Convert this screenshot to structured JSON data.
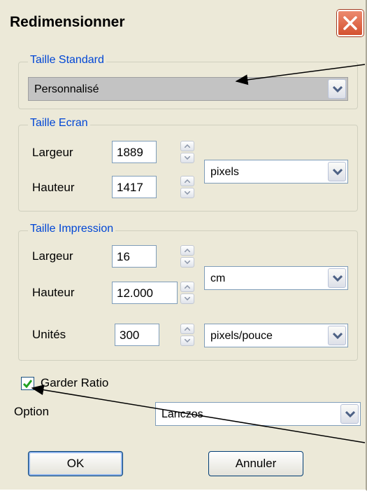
{
  "window": {
    "title": "Redimensionner",
    "close_icon": "close-icon"
  },
  "standard": {
    "legend": "Taille Standard",
    "selected": "Personnalisé"
  },
  "screen": {
    "legend": "Taille Ecran",
    "width_label": "Largeur",
    "width_value": "1889",
    "height_label": "Hauteur",
    "height_value": "1417",
    "unit": "pixels"
  },
  "print": {
    "legend": "Taille Impression",
    "width_label": "Largeur",
    "width_value": "16",
    "height_label": "Hauteur",
    "height_value": "12.000",
    "unit": "cm",
    "units_label": "Unités",
    "units_value": "300",
    "units_unit": "pixels/pouce"
  },
  "ratio": {
    "label": "Garder Ratio",
    "checked": true
  },
  "option": {
    "label": "Option",
    "selected": "Lanczos"
  },
  "buttons": {
    "ok": "OK",
    "cancel": "Annuler"
  },
  "colors": {
    "legend": "#0046d5",
    "dialog_bg": "#ece9d8",
    "checkmark": "#21a121",
    "close_red": "#d4512f"
  }
}
